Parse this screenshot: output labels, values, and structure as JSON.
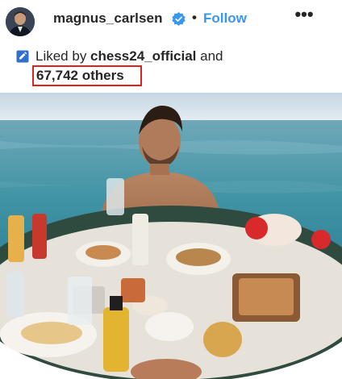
{
  "post": {
    "username": "magnus_carlsen",
    "separator": "•",
    "follow_label": "Follow",
    "more_label": "•••"
  },
  "likes": {
    "prefix": "Liked by ",
    "liker": "chess24_official",
    "conjunction": " and",
    "others": "67,742 others"
  },
  "colors": {
    "link_blue": "#3897f0",
    "highlight_red": "#e0201b",
    "verified_blue": "#3897f0"
  },
  "icons": {
    "verified": "verified-badge-icon",
    "more": "more-options-icon",
    "like": "like-icon"
  }
}
